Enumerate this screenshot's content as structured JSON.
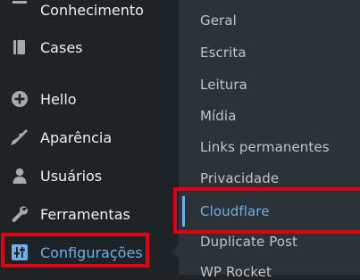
{
  "sidebar": {
    "items": [
      {
        "label": "Conhecimento",
        "icon": "knowledge-icon"
      },
      {
        "label": "Cases",
        "icon": "book-icon"
      },
      {
        "label": "Hello",
        "icon": "plus-circle-icon"
      },
      {
        "label": "Aparência",
        "icon": "paintbrush-icon"
      },
      {
        "label": "Usuários",
        "icon": "user-icon"
      },
      {
        "label": "Ferramentas",
        "icon": "wrench-icon"
      },
      {
        "label": "Configurações",
        "icon": "settings-sliders-icon",
        "active": true
      }
    ]
  },
  "submenu": {
    "items": [
      {
        "label": "Geral"
      },
      {
        "label": "Escrita"
      },
      {
        "label": "Leitura"
      },
      {
        "label": "Mídia"
      },
      {
        "label": "Links permanentes"
      },
      {
        "label": "Privacidade"
      },
      {
        "label": "Cloudflare",
        "current": true
      },
      {
        "label": "Duplicate Post"
      },
      {
        "label": "WP Rocket"
      }
    ]
  },
  "colors": {
    "sidebar_bg": "#1d2327",
    "submenu_bg": "#2c3338",
    "text": "#f0f0f1",
    "submenu_text": "#c3c4c7",
    "accent": "#72aee6",
    "highlight_outline": "#e3000f"
  }
}
